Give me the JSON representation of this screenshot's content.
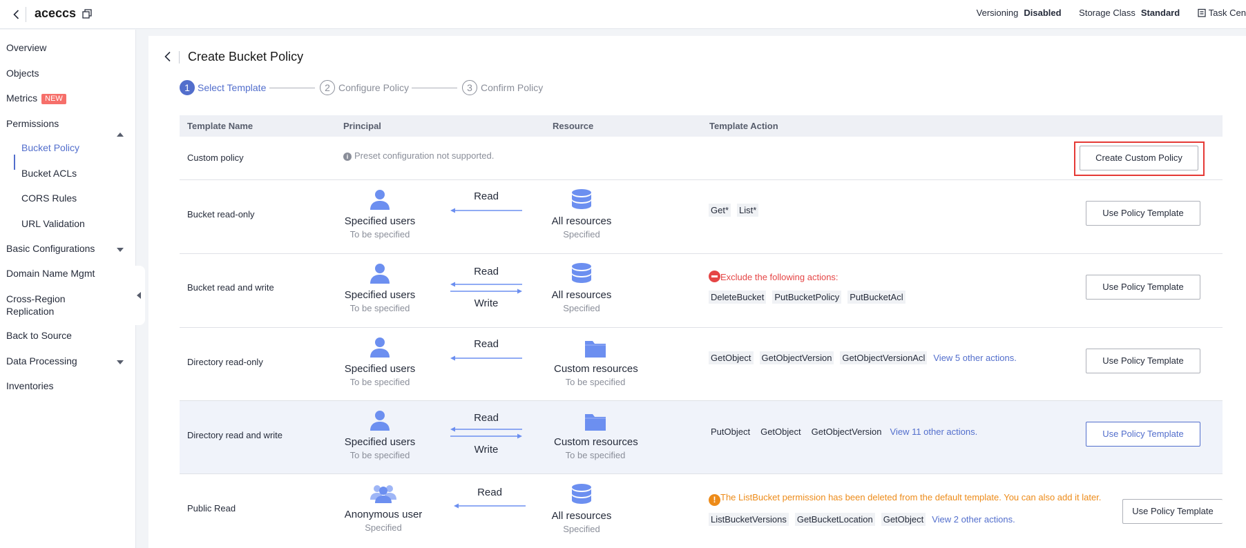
{
  "topbar": {
    "bucket_name": "aceccs",
    "versioning_label": "Versioning",
    "versioning_value": "Disabled",
    "storage_class_label": "Storage Class",
    "storage_class_value": "Standard",
    "task_center": "Task Cen"
  },
  "sidebar": {
    "overview": "Overview",
    "objects": "Objects",
    "metrics": "Metrics",
    "new_badge": "NEW",
    "permissions": "Permissions",
    "bucket_policy": "Bucket Policy",
    "bucket_acls": "Bucket ACLs",
    "cors_rules": "CORS Rules",
    "url_validation": "URL Validation",
    "basic_configurations": "Basic Configurations",
    "domain_name_mgmt": "Domain Name Mgmt",
    "cross_region_1": "Cross-Region",
    "cross_region_2": "Replication",
    "back_to_source": "Back to Source",
    "data_processing": "Data Processing",
    "inventories": "Inventories"
  },
  "page": {
    "title": "Create Bucket Policy",
    "steps": [
      {
        "num": "1",
        "label": "Select Template"
      },
      {
        "num": "2",
        "label": "Configure Policy"
      },
      {
        "num": "3",
        "label": "Confirm Policy"
      }
    ]
  },
  "table": {
    "headers": [
      "Template Name",
      "Principal",
      "Resource",
      "Template Action"
    ],
    "rows": [
      {
        "name": "Custom policy",
        "note": "Preset configuration not supported.",
        "button": "Create Custom Policy"
      },
      {
        "name": "Bucket read-only",
        "principal": "Specified users",
        "principal_sub": "To be specified",
        "arrow_top": "Read",
        "resource": "All resources",
        "resource_sub": "Specified",
        "actions": [
          "Get*",
          "List*"
        ],
        "button": "Use Policy Template"
      },
      {
        "name": "Bucket read and write",
        "principal": "Specified users",
        "principal_sub": "To be specified",
        "arrow_top": "Read",
        "arrow_bottom": "Write",
        "resource": "All resources",
        "resource_sub": "Specified",
        "warning": "Exclude the following actions:",
        "actions": [
          "DeleteBucket",
          "PutBucketPolicy",
          "PutBucketAcl"
        ],
        "button": "Use Policy Template"
      },
      {
        "name": "Directory read-only",
        "principal": "Specified users",
        "principal_sub": "To be specified",
        "arrow_top": "Read",
        "resource": "Custom resources",
        "resource_sub": "To be specified",
        "actions": [
          "GetObject",
          "GetObjectVersion",
          "GetObjectVersionAcl"
        ],
        "more_link": "View 5 other actions.",
        "button": "Use Policy Template"
      },
      {
        "name": "Directory read and write",
        "principal": "Specified users",
        "principal_sub": "To be specified",
        "arrow_top": "Read",
        "arrow_bottom": "Write",
        "resource": "Custom resources",
        "resource_sub": "To be specified",
        "actions": [
          "PutObject",
          "GetObject",
          "GetObjectVersion"
        ],
        "more_link": "View 11 other actions.",
        "button": "Use Policy Template"
      },
      {
        "name": "Public Read",
        "principal": "Anonymous user",
        "principal_sub": "Specified",
        "arrow_top": "Read",
        "resource": "All resources",
        "resource_sub": "Specified",
        "warning": "The ListBucket permission has been deleted from the default template. You can also add it later.",
        "actions": [
          "ListBucketVersions",
          "GetBucketLocation",
          "GetObject"
        ],
        "more_link": "View 2 other actions.",
        "button": "Use Policy Template"
      }
    ]
  },
  "colors": {
    "accent": "#526ecc",
    "icon_blue": "#6c8ff0",
    "error": "#e54545",
    "warning": "#ed8b19",
    "highlight_box": "#e53935"
  }
}
